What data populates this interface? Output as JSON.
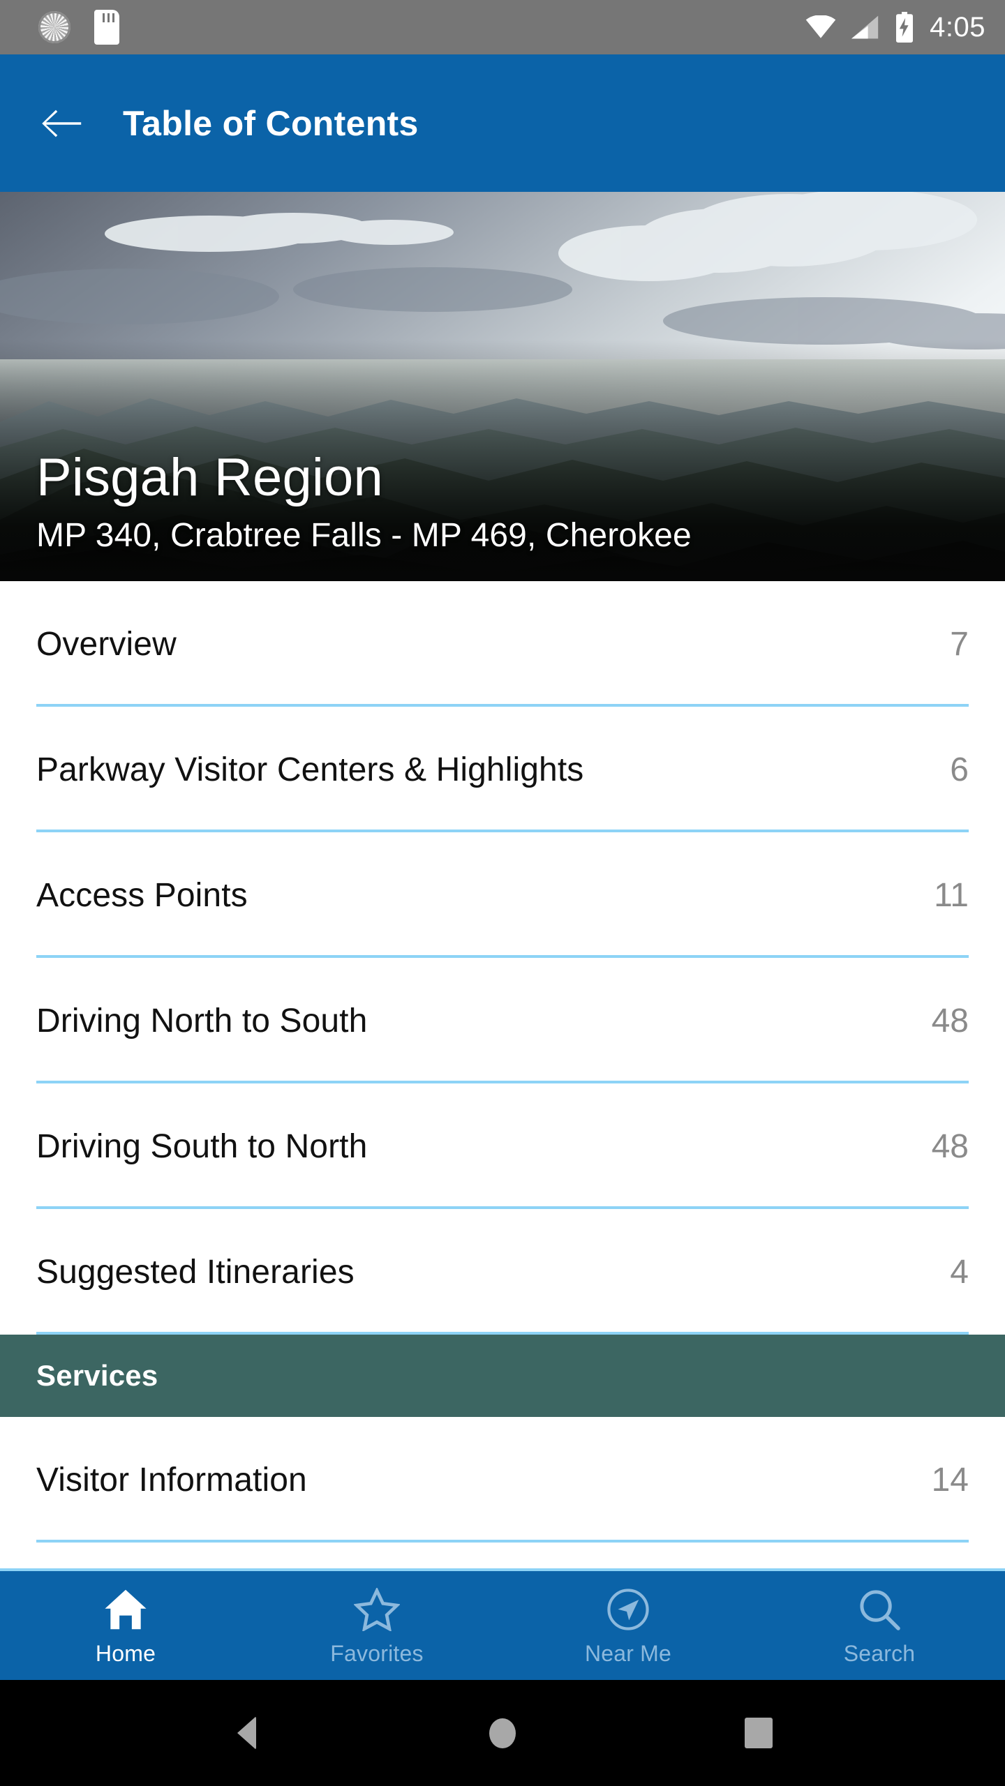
{
  "status_bar": {
    "icons_left": [
      "sync-icon",
      "sd-card-icon"
    ],
    "icons_right": [
      "wifi-icon",
      "cellular-signal-icon",
      "battery-charging-icon"
    ],
    "time": "4:05"
  },
  "app_bar": {
    "back_icon": "back-arrow-icon",
    "title": "Table of Contents",
    "background_color": "#0b63a8"
  },
  "hero": {
    "image_alt": "blue-ridge-mountains-photo",
    "title": "Pisgah Region",
    "subtitle": "MP 340, Crabtree Falls - MP 469, Cherokee"
  },
  "toc": {
    "rows": [
      {
        "label": "Overview",
        "count": "7"
      },
      {
        "label": "Parkway Visitor Centers & Highlights",
        "count": "6"
      },
      {
        "label": "Access Points",
        "count": "11"
      },
      {
        "label": "Driving North to South",
        "count": "48"
      },
      {
        "label": "Driving South to North",
        "count": "48"
      },
      {
        "label": "Suggested Itineraries",
        "count": "4"
      }
    ],
    "section": {
      "label": "Services",
      "background_color": "#3c6662"
    },
    "section_rows": [
      {
        "label": "Visitor Information",
        "count": "14"
      }
    ],
    "divider_color": "#8dd3f6"
  },
  "bottom_nav": {
    "background_color": "#0b63a8",
    "active_color": "#ffffff",
    "inactive_color": "#8cb9dd",
    "items": [
      {
        "label": "Home",
        "icon": "home-icon",
        "active": true
      },
      {
        "label": "Favorites",
        "icon": "star-icon",
        "active": false
      },
      {
        "label": "Near Me",
        "icon": "navigation-icon",
        "active": false
      },
      {
        "label": "Search",
        "icon": "search-icon",
        "active": false
      }
    ]
  },
  "android_nav": {
    "items": [
      "back-button",
      "home-button",
      "recents-button"
    ]
  }
}
